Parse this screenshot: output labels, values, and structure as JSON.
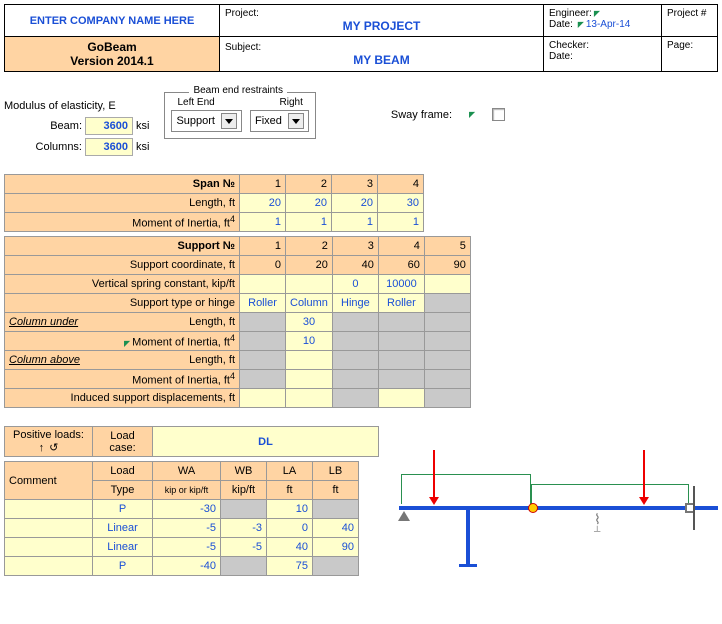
{
  "header": {
    "company": "ENTER COMPANY NAME HERE",
    "app_name": "GoBeam",
    "version": "Version 2014.1",
    "project_lbl": "Project:",
    "project": "MY PROJECT",
    "subject_lbl": "Subject:",
    "subject": "MY BEAM",
    "engineer_lbl": "Engineer:",
    "date_lbl": "Date:",
    "date": "13-Apr-14",
    "checker_lbl": "Checker:",
    "date2_lbl": "Date:",
    "projectnum_lbl": "Project #",
    "page_lbl": "Page:"
  },
  "elasticity": {
    "title": "Modulus of elasticity, E",
    "beam_lbl": "Beam:",
    "beam_val": "3600",
    "col_lbl": "Columns:",
    "col_val": "3600",
    "unit": "ksi"
  },
  "restraints": {
    "title": "Beam end restraints",
    "left_lbl": "Left End",
    "right_lbl": "Right",
    "left_val": "Support",
    "right_val": "Fixed"
  },
  "sway": {
    "label": "Sway frame:"
  },
  "span": {
    "title": "Span №",
    "length_lbl": "Length, ft",
    "moi_lbl": "Moment of Inertia, ft",
    "cols": [
      "1",
      "2",
      "3",
      "4"
    ],
    "length": [
      "20",
      "20",
      "20",
      "30"
    ],
    "moi": [
      "1",
      "1",
      "1",
      "1"
    ]
  },
  "support": {
    "title": "Support №",
    "coord_lbl": "Support coordinate, ft",
    "spring_lbl": "Vertical spring constant, kip/ft",
    "type_lbl": "Support type or hinge",
    "col_under": "Column under",
    "col_above": "Column above",
    "len_lbl": "Length, ft",
    "moi_lbl": "Moment of Inertia, ft",
    "disp_lbl": "Induced support displacements, ft",
    "cols": [
      "1",
      "2",
      "3",
      "4",
      "5"
    ],
    "coord": [
      "0",
      "20",
      "40",
      "60",
      "90"
    ],
    "spring": [
      "",
      "",
      "0",
      "10000",
      ""
    ],
    "type": [
      "Roller",
      "Column",
      "Hinge",
      "Roller",
      ""
    ],
    "under_len": [
      "",
      "30",
      "",
      "",
      ""
    ],
    "under_moi": [
      "",
      "10",
      "",
      "",
      ""
    ]
  },
  "loads": {
    "pos_lbl": "Positive loads:",
    "lc_lbl": "Load case:",
    "lc_val": "DL",
    "comment": "Comment",
    "type_hdr": "Load",
    "type_hdr2": "Type",
    "wa": "WA",
    "wa2": "kip or kip/ft",
    "wb": "WB",
    "wb2": "kip/ft",
    "la": "LA",
    "la2": "ft",
    "lb": "LB",
    "lb2": "ft",
    "rows": [
      {
        "type": "P",
        "wa": "-30",
        "wb": "",
        "la": "10",
        "lb": ""
      },
      {
        "type": "Linear",
        "wa": "-5",
        "wb": "-3",
        "la": "0",
        "lb": "40"
      },
      {
        "type": "Linear",
        "wa": "-5",
        "wb": "-5",
        "la": "40",
        "lb": "90"
      },
      {
        "type": "P",
        "wa": "-40",
        "wb": "",
        "la": "75",
        "lb": ""
      }
    ]
  }
}
